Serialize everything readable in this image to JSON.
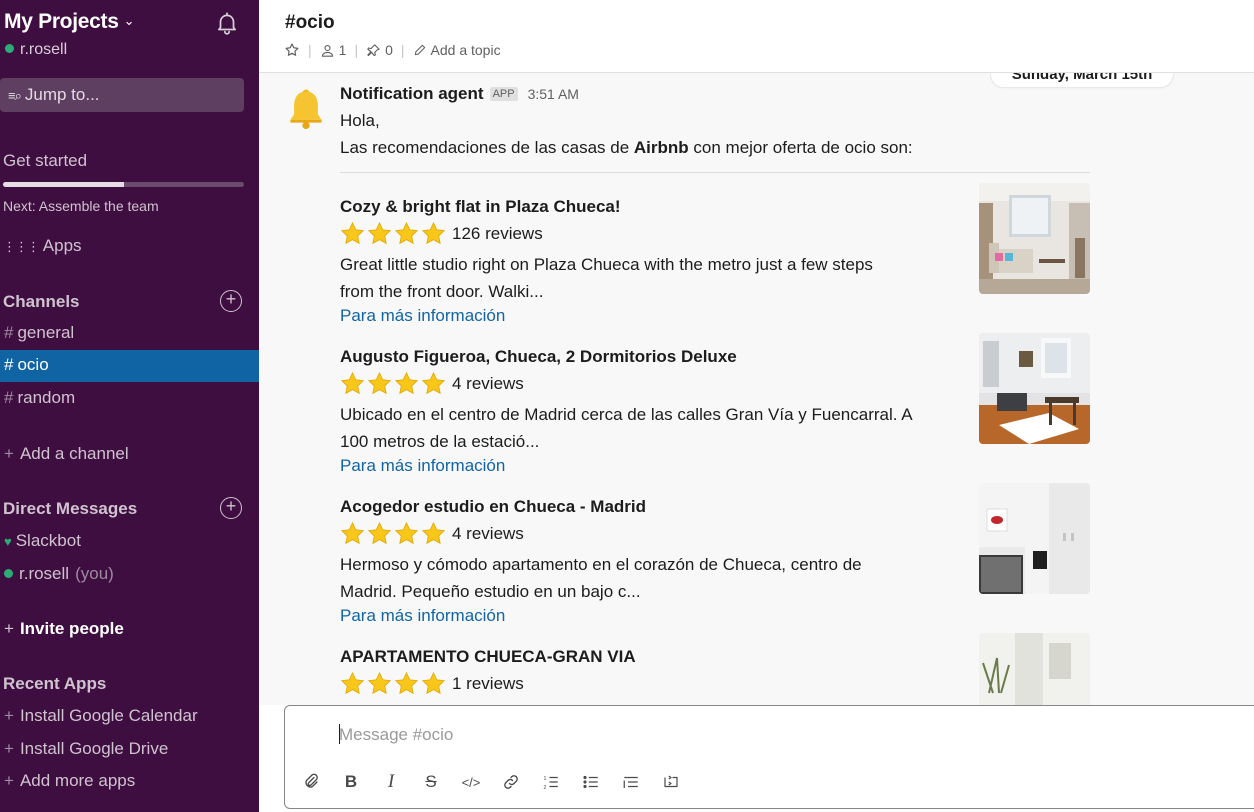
{
  "workspace": {
    "name": "My Projects",
    "user": "r.rosell"
  },
  "sidebar": {
    "jump_to": "Jump to...",
    "get_started": "Get started",
    "get_started_progress": 0.5,
    "next_step": "Next: Assemble the team",
    "apps": "Apps",
    "channels_header": "Channels",
    "channels": [
      {
        "name": "general",
        "active": false
      },
      {
        "name": "ocio",
        "active": true
      },
      {
        "name": "random",
        "active": false
      }
    ],
    "add_channel": "Add a channel",
    "dm_header": "Direct Messages",
    "dms": [
      {
        "name": "Slackbot",
        "suffix": ""
      },
      {
        "name": "r.rosell",
        "suffix": "(you)"
      }
    ],
    "invite_people": "Invite people",
    "recent_apps_header": "Recent Apps",
    "recent_apps": [
      "Install Google Calendar",
      "Install Google Drive",
      "Add more apps"
    ]
  },
  "header": {
    "channel_title": "#ocio",
    "members_count": "1",
    "pins_count": "0",
    "add_topic": "Add a topic"
  },
  "messages": {
    "date_divider": "Sunday, March 15th",
    "sender": "Notification agent",
    "badge": "APP",
    "time": "3:51 AM",
    "greeting": "Hola,",
    "intro_before": "Las recomendaciones de las casas de ",
    "intro_bold": "Airbnb",
    "intro_after": " con mejor oferta de ocio son:",
    "listings": [
      {
        "title": "Cozy & bright flat in Plaza Chueca!",
        "rating_stars": 4,
        "reviews": "126 reviews",
        "desc_line1": "Great little studio right on Plaza Chueca with the metro just a few steps",
        "desc_line2": "from the front door. Walki...",
        "link": "Para más información"
      },
      {
        "title": "Augusto Figueroa, Chueca, 2 Dormitorios Deluxe",
        "rating_stars": 4,
        "reviews": "4 reviews",
        "desc_line1": "Ubicado en el centro de Madrid cerca de las calles Gran Vía y Fuencarral. A",
        "desc_line2": "100 metros de la estació...",
        "link": "Para más información"
      },
      {
        "title": "Acogedor estudio en Chueca - Madrid",
        "rating_stars": 4,
        "reviews": "4 reviews",
        "desc_line1": "Hermoso y cómodo apartamento en el corazón de Chueca, centro de",
        "desc_line2": "Madrid. Pequeño estudio en un bajo c...",
        "link": "Para más información"
      },
      {
        "title": "APARTAMENTO CHUECA-GRAN VIA",
        "rating_stars": 4,
        "reviews": "1 reviews",
        "desc_line1": "",
        "desc_line2": "",
        "link": ""
      }
    ]
  },
  "composer": {
    "placeholder": "Message #ocio"
  },
  "colors": {
    "sidebar_bg": "#3f0e40",
    "active_channel": "#1164a3",
    "link": "#1264a3",
    "presence": "#2bac76"
  }
}
